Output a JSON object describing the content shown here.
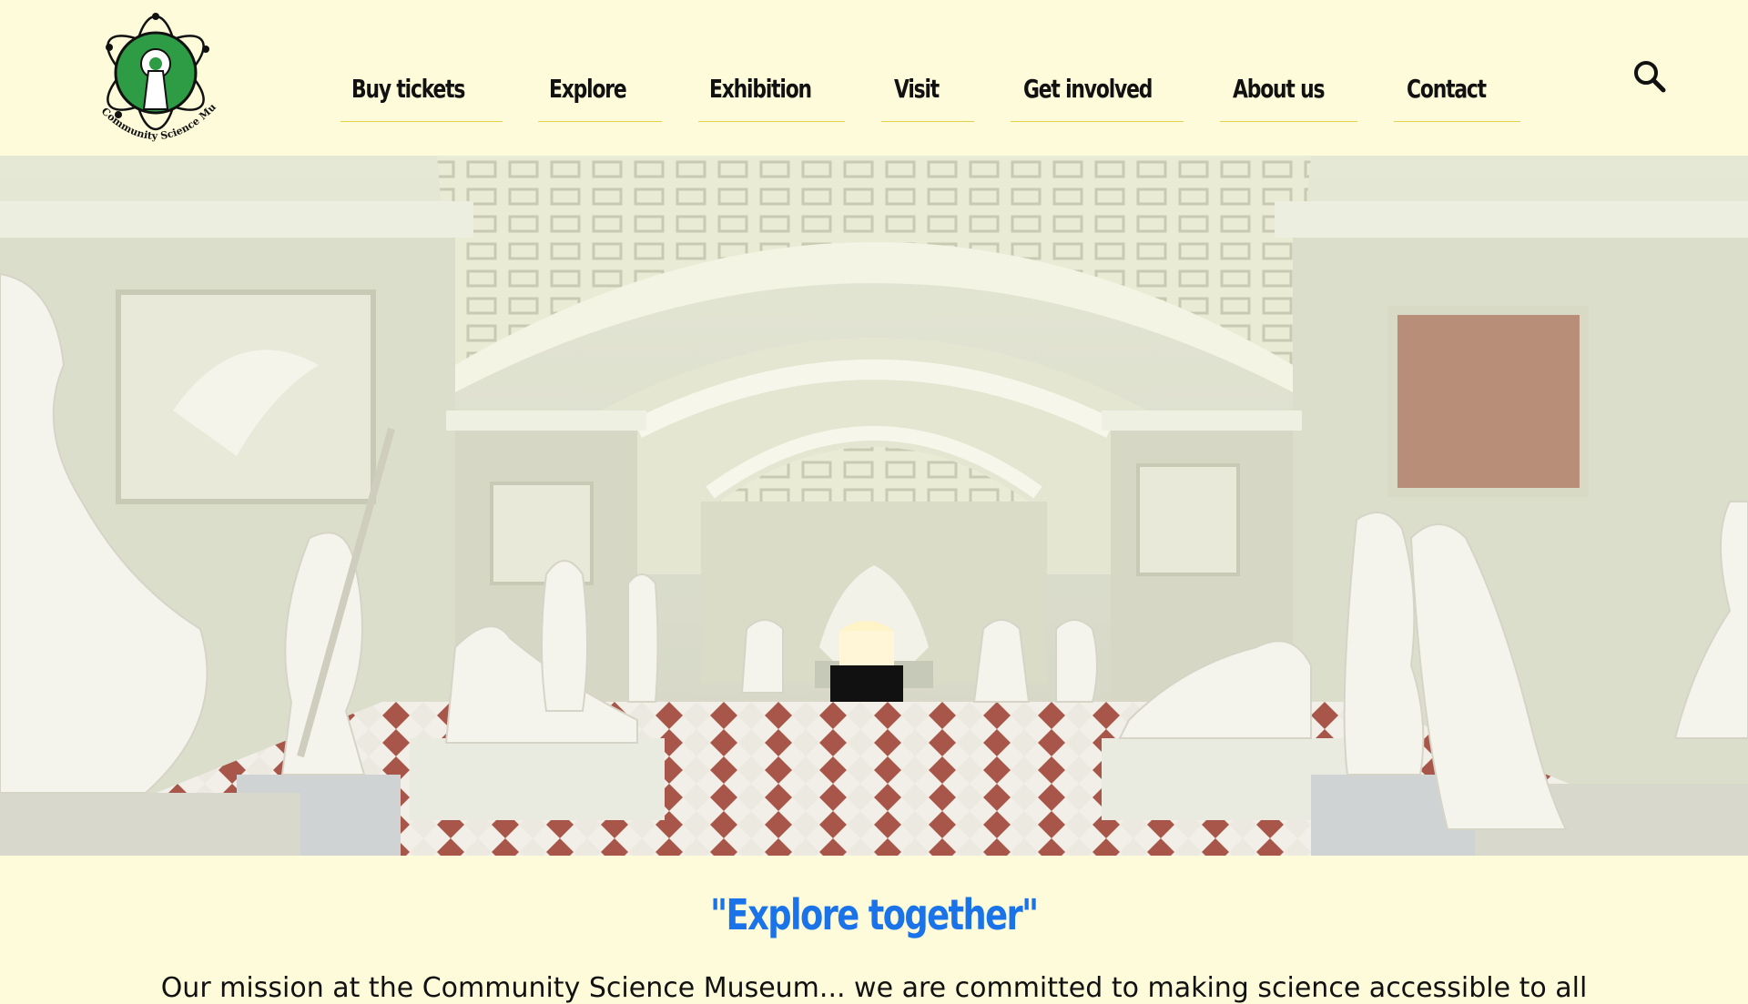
{
  "logo": {
    "alt_text": "Community Science Museum",
    "accent_color": "#2e9b45"
  },
  "nav": {
    "items": [
      {
        "label": "Buy tickets"
      },
      {
        "label": "Explore"
      },
      {
        "label": "Exhibition"
      },
      {
        "label": "Visit"
      },
      {
        "label": "Get involved"
      },
      {
        "label": "About us"
      },
      {
        "label": "Contact"
      }
    ],
    "search_icon": "search-icon",
    "underline_color": "#e6d04a"
  },
  "hero": {
    "image_subject": "sculpture-gallery-photo"
  },
  "tagline": "\"Explore together\"",
  "intro_text": "Our mission at the Community Science Museum... we are committed to making science accessible to all",
  "colors": {
    "background": "#fdfbd9",
    "tagline": "#1a73e8",
    "nav_text": "#111111"
  }
}
